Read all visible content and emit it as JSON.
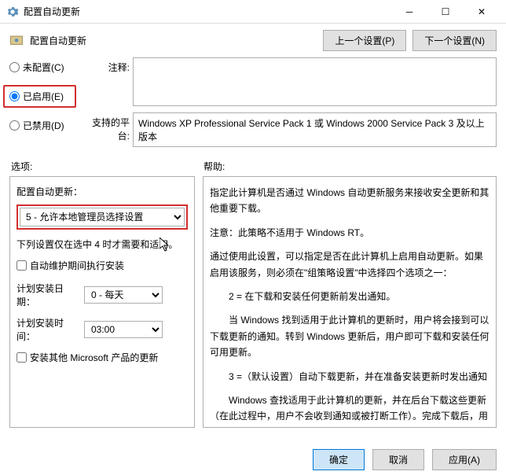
{
  "window": {
    "title": "配置自动更新"
  },
  "header": {
    "title": "配置自动更新",
    "prev_btn": "上一个设置(P)",
    "next_btn": "下一个设置(N)"
  },
  "state": {
    "not_configured": "未配置(C)",
    "enabled": "已启用(E)",
    "disabled": "已禁用(D)"
  },
  "fields": {
    "comment_label": "注释:",
    "comment_value": "",
    "platform_label": "支持的平台:",
    "platform_value": "Windows XP Professional Service Pack 1 或 Windows 2000 Service Pack 3 及以上版本"
  },
  "section_labels": {
    "options": "选项:",
    "help": "帮助:"
  },
  "options": {
    "config_label": "配置自动更新：",
    "config_selected": "5 - 允许本地管理员选择设置",
    "note": "下列设置仅在选中 4 时才需要和适用。",
    "auto_maint": "自动维护期间执行安装",
    "sched_day_label": "计划安装日期：",
    "sched_day_value": "0 - 每天",
    "sched_time_label": "计划安装时间：",
    "sched_time_value": "03:00",
    "install_other": "安装其他 Microsoft 产品的更新"
  },
  "help": {
    "p1": "指定此计算机是否通过 Windows 自动更新服务来接收安全更新和其他重要下载。",
    "p2": "注意：此策略不适用于 Windows RT。",
    "p3": "通过使用此设置，可以指定是否在此计算机上启用自动更新。如果启用该服务，则必须在\"组策略设置\"中选择四个选项之一：",
    "p4": "2 = 在下载和安装任何更新前发出通知。",
    "p5": "当 Windows 找到适用于此计算机的更新时，用户将会接到可以下载更新的通知。转到 Windows 更新后，用户即可下载和安装任何可用更新。",
    "p6": "3 =（默认设置）自动下载更新，并在准备安装更新时发出通知",
    "p7": "Windows 查找适用于此计算机的更新，并在后台下载这些更新（在此过程中，用户不会收到通知或被打断工作）。完成下载后，用户将收到可以安装更新的通知。转到 Windows 更新后，用户即可安装更新。"
  },
  "footer": {
    "ok": "确定",
    "cancel": "取消",
    "apply": "应用(A)"
  }
}
